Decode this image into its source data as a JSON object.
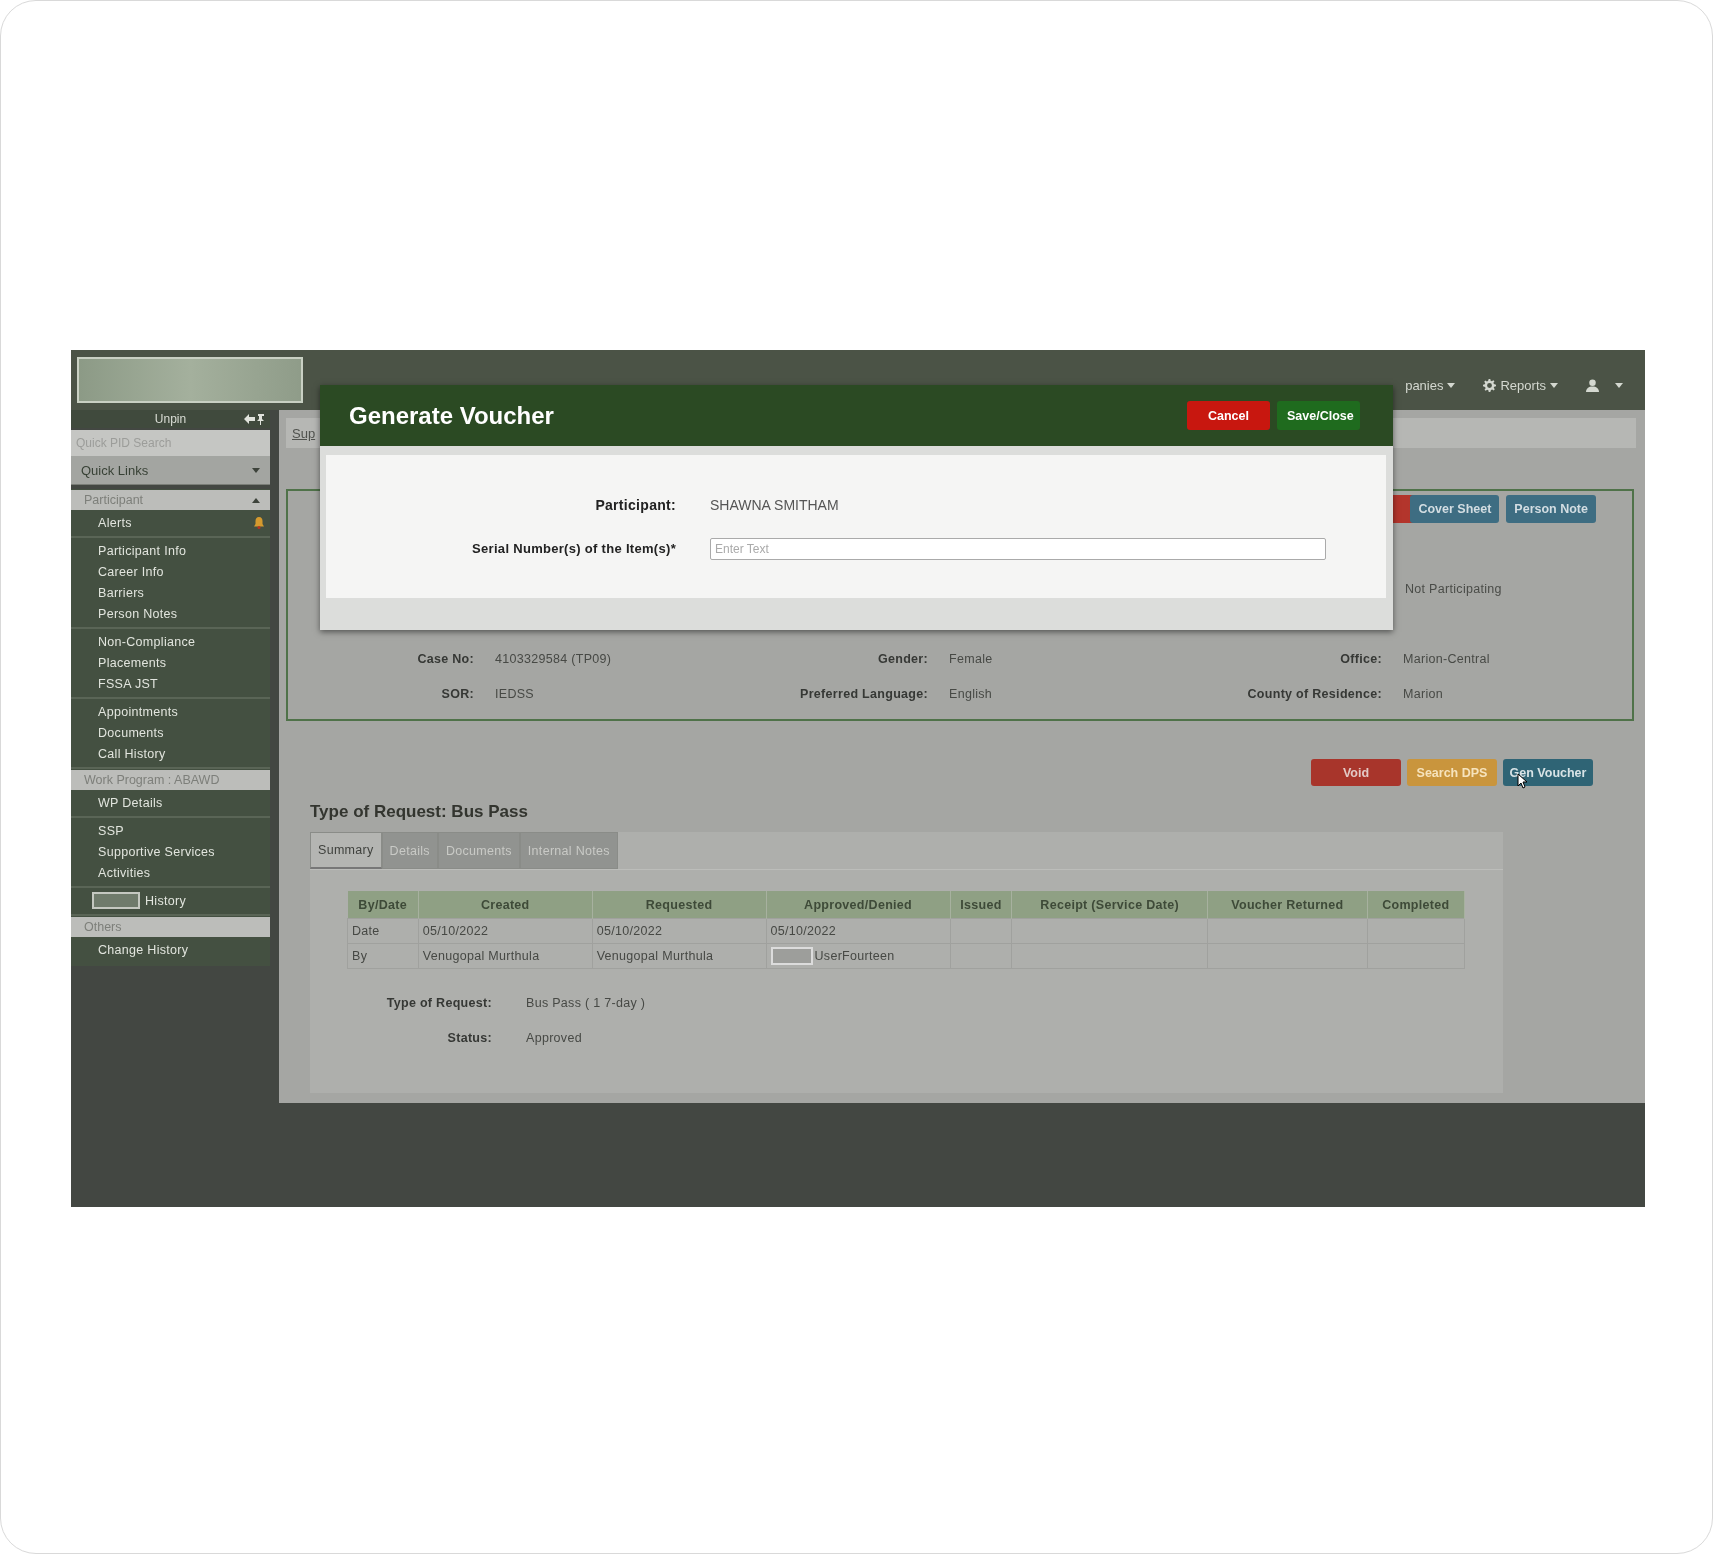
{
  "top_nav": {
    "items": [
      {
        "label": "panies",
        "kind": "text"
      },
      {
        "label": "Reports",
        "kind": "gear"
      }
    ]
  },
  "sidebar": {
    "unpin_label": "Unpin",
    "search_placeholder": "Quick PID Search",
    "quick_links": "Quick Links",
    "sections": [
      {
        "title": "Participant",
        "collapsible": true,
        "groups": [
          [
            {
              "label": "Alerts",
              "kind": "alert"
            }
          ],
          [
            {
              "label": "Participant Info",
              "kind": "link"
            },
            {
              "label": "Career Info",
              "kind": "link"
            },
            {
              "label": "Barriers",
              "kind": "link"
            },
            {
              "label": "Person Notes",
              "kind": "link"
            }
          ],
          [
            {
              "label": "Non-Compliance",
              "kind": "link"
            },
            {
              "label": "Placements",
              "kind": "link"
            },
            {
              "label": "FSSA JST",
              "kind": "link"
            }
          ],
          [
            {
              "label": "Appointments",
              "kind": "link"
            },
            {
              "label": "Documents",
              "kind": "link"
            },
            {
              "label": "Call History",
              "kind": "link"
            }
          ]
        ]
      },
      {
        "title": "Work Program : ABAWD",
        "collapsible": false,
        "groups": [
          [
            {
              "label": "WP Details",
              "kind": "link"
            }
          ],
          [
            {
              "label": "SSP",
              "kind": "link"
            },
            {
              "label": "Supportive Services",
              "kind": "link"
            },
            {
              "label": "Activities",
              "kind": "link"
            }
          ],
          [
            {
              "label": "History",
              "kind": "redacted"
            }
          ]
        ]
      },
      {
        "title": "Others",
        "collapsible": false,
        "groups": [
          [
            {
              "label": "Change History",
              "kind": "link"
            }
          ]
        ]
      }
    ]
  },
  "breadcrumb": "Sup",
  "participant_panel": {
    "buttons": [
      {
        "label": "Cover Sheet"
      },
      {
        "label": "Person Note"
      }
    ],
    "status_value": "Not Participating",
    "rows": [
      [
        {
          "label": "Case No:",
          "value": "4103329584 (TP09)"
        },
        {
          "label": "Gender:",
          "value": "Female"
        },
        {
          "label": "Office:",
          "value": "Marion-Central"
        }
      ],
      [
        {
          "label": "SOR:",
          "value": "IEDSS"
        },
        {
          "label": "Preferred Language:",
          "value": "English"
        },
        {
          "label": "County of Residence:",
          "value": "Marion"
        }
      ]
    ]
  },
  "actions": [
    {
      "label": "Void",
      "kind": "danger"
    },
    {
      "label": "Search DPS",
      "kind": "warning"
    },
    {
      "label": "Gen Voucher",
      "kind": "primary"
    }
  ],
  "request": {
    "title": "Type of Request: Bus Pass",
    "tabs": [
      {
        "label": "Summary",
        "selected": true
      },
      {
        "label": "Details",
        "selected": false
      },
      {
        "label": "Documents",
        "selected": false
      },
      {
        "label": "Internal Notes",
        "selected": false
      }
    ],
    "table": {
      "columns": [
        "By/Date",
        "Created",
        "Requested",
        "Approved/Denied",
        "Issued",
        "Receipt (Service Date)",
        "Voucher Returned",
        "Completed"
      ],
      "rows": [
        [
          "Date",
          "05/10/2022",
          "05/10/2022",
          "05/10/2022"
        ],
        [
          "By",
          "Venugopal Murthula",
          "Venugopal Murthula",
          {
            "text": "UserFourteen",
            "kind": "redacted"
          }
        ]
      ]
    },
    "fields": [
      {
        "label": "Type of Request:",
        "value": "Bus Pass ( 1 7-day )"
      },
      {
        "label": "Status:",
        "value": "Approved"
      }
    ]
  },
  "modal": {
    "title": "Generate Voucher",
    "buttons": [
      {
        "label": "Cancel",
        "kind": "danger"
      },
      {
        "label": "Save/Close",
        "kind": "success"
      }
    ],
    "fields": [
      {
        "label": "Participant:",
        "value": "SHAWNA SMITHAM",
        "kind": "text"
      },
      {
        "label": "Serial Number(s) of the Item(s)*",
        "placeholder": "Enter Text",
        "kind": "input"
      }
    ]
  }
}
